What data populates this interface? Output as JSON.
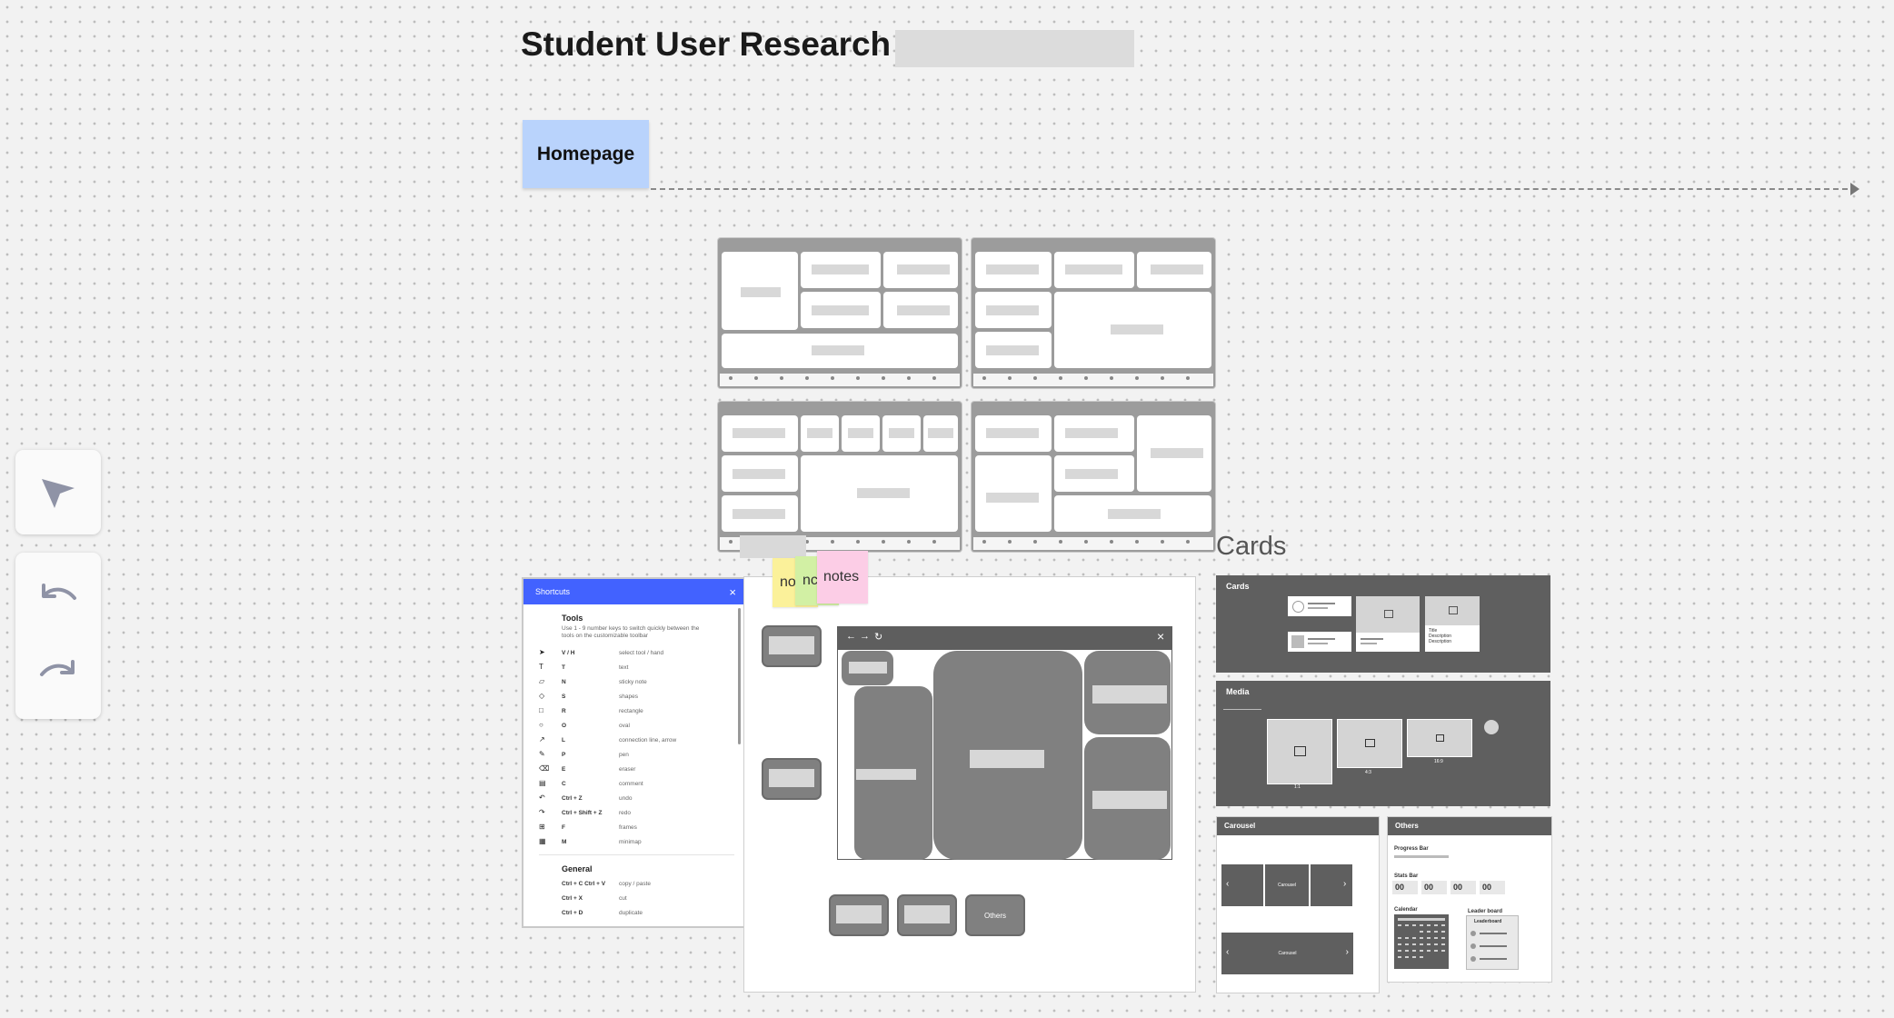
{
  "board": {
    "title": "Student User Research",
    "frame_label": "Homepage",
    "cards_caption": "Cards"
  },
  "toolbar": {
    "select_tool": "select-arrow-icon",
    "undo": "undo-icon",
    "redo": "redo-icon"
  },
  "stickies": [
    {
      "text": "no",
      "color": "#fbf19a"
    },
    {
      "text": "nc",
      "color": "#d2f0a4"
    },
    {
      "text": "notes",
      "color": "#fccde6"
    }
  ],
  "shortcuts": {
    "header": "Shortcuts",
    "close": "×",
    "tools_heading": "Tools",
    "tools_desc": "Use 1 - 9 number keys to switch quickly between the tools on the customizable toolbar",
    "rows": [
      {
        "icon": "➤",
        "keys": "V / H",
        "desc": "select tool / hand"
      },
      {
        "icon": "T",
        "keys": "T",
        "desc": "text"
      },
      {
        "icon": "▱",
        "keys": "N",
        "desc": "sticky note"
      },
      {
        "icon": "◇",
        "keys": "S",
        "desc": "shapes"
      },
      {
        "icon": "□",
        "keys": "R",
        "desc": "rectangle"
      },
      {
        "icon": "○",
        "keys": "O",
        "desc": "oval"
      },
      {
        "icon": "↗",
        "keys": "L",
        "desc": "connection line, arrow"
      },
      {
        "icon": "✎",
        "keys": "P",
        "desc": "pen"
      },
      {
        "icon": "⌫",
        "keys": "E",
        "desc": "eraser"
      },
      {
        "icon": "▤",
        "keys": "C",
        "desc": "comment"
      },
      {
        "icon": "↶",
        "keys": "Ctrl + Z",
        "desc": "undo"
      },
      {
        "icon": "↷",
        "keys": "Ctrl + Shift + Z",
        "desc": "redo"
      },
      {
        "icon": "⊞",
        "keys": "F",
        "desc": "frames"
      },
      {
        "icon": "▦",
        "keys": "M",
        "desc": "minimap"
      }
    ],
    "general_heading": "General",
    "general_rows": [
      {
        "keys": "Ctrl + C   Ctrl + V",
        "desc": "copy / paste"
      },
      {
        "keys": "Ctrl + X",
        "desc": "cut"
      },
      {
        "keys": "Ctrl + D",
        "desc": "duplicate"
      }
    ]
  },
  "canvas": {
    "window_controls": [
      "←",
      "→",
      "↻"
    ],
    "window_close": "×",
    "others_label": "Others"
  },
  "components": {
    "cards_title": "Cards",
    "card_text": {
      "title": "Title",
      "desc1": "Description",
      "desc2": "Description"
    },
    "media_title": "Media",
    "media_ratios": [
      "1:1",
      "4:3",
      "16:9"
    ],
    "carousel_title": "Carousel",
    "carousel_label": "Carousel",
    "carousel_label_2": "Carousel",
    "others_title": "Others",
    "progress_label": "Progress Bar",
    "stats_label": "Stats Bar",
    "stats_values": [
      "00",
      "00",
      "00",
      "00"
    ],
    "calendar_label": "Calendar",
    "leaderboard_label": "Leader board",
    "leaderboard_inner": "Leaderboard"
  }
}
